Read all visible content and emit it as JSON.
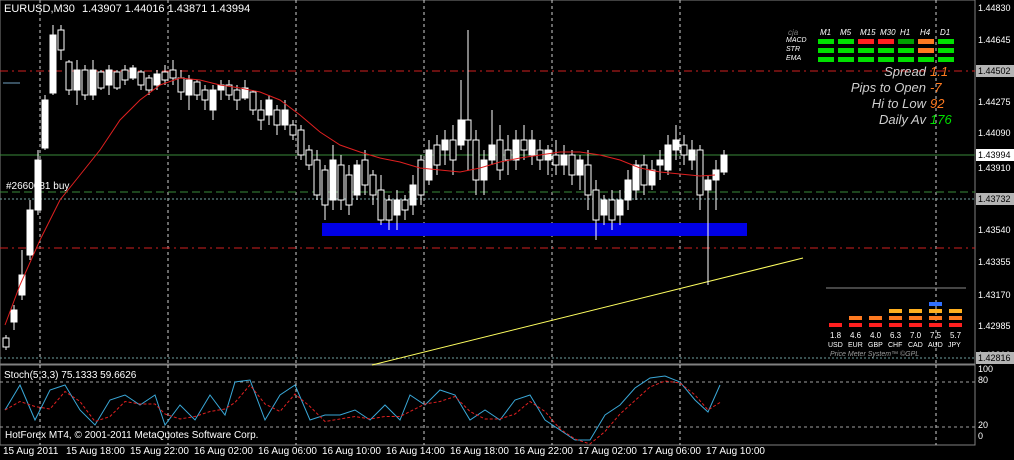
{
  "chart_header": {
    "symbol": "EURUSD,M30",
    "ohlc": "1.43907 1.44016 1.43871 1.43994"
  },
  "price_axis": [
    "1.44830",
    "1.44645",
    "1.44460",
    "1.44275",
    "1.44090",
    "1.43910",
    "1.43725",
    "1.43540",
    "1.43355",
    "1.43170",
    "1.42985",
    "1.42816"
  ],
  "price_boxes": [
    {
      "value": "1.44502",
      "color": "#b4b4b4"
    },
    {
      "value": "1.43994",
      "color": "#ffffff"
    },
    {
      "value": "1.43732",
      "color": "#b4b4b4"
    },
    {
      "value": "1.42816",
      "color": "#b4b4b4"
    }
  ],
  "time_axis": [
    "15 Aug 2011",
    "15 Aug 18:00",
    "15 Aug 22:00",
    "16 Aug 02:00",
    "16 Aug 06:00",
    "16 Aug 10:00",
    "16 Aug 14:00",
    "16 Aug 18:00",
    "16 Aug 22:00",
    "17 Aug 02:00",
    "17 Aug 06:00",
    "17 Aug 10:00"
  ],
  "order_label": "#2660081 buy",
  "stochastic": {
    "label": "Stoch(5,3,3) 75.1333 59.6626",
    "levels": [
      "100",
      "80",
      "20",
      "0"
    ]
  },
  "copyright": "HotForex MT4, © 2001-2011 MetaQuotes Software Corp.",
  "signal_grid": {
    "timeframes": [
      "M1",
      "M5",
      "M15",
      "M30",
      "H1",
      "H4",
      "D1"
    ],
    "rows": [
      {
        "name": "MACD",
        "colors": [
          "#00e000",
          "#00e000",
          "#ff2020",
          "#ff2020",
          "#00a000",
          "#ff7a20",
          "#00e000"
        ]
      },
      {
        "name": "STR",
        "colors": [
          "#00e000",
          "#00e000",
          "#00e000",
          "#00e000",
          "#00e000",
          "#ff7a20",
          "#00e000"
        ]
      },
      {
        "name": "EMA",
        "colors": [
          "#00e000",
          "#00e000",
          "#00e000",
          "#00e000",
          "#00e000",
          "#00e000",
          "#00e000"
        ]
      }
    ],
    "corner": "cja"
  },
  "stats": [
    {
      "label": "Spread",
      "value": "1.1",
      "color": "#ff7a20"
    },
    {
      "label": "Pips to Open",
      "value": "-7",
      "color": "#ff7a20"
    },
    {
      "label": "Hi to Low",
      "value": "92",
      "color": "#ff7a20"
    },
    {
      "label": "Daily Av",
      "value": "176",
      "color": "#00e000"
    }
  ],
  "price_meter": {
    "currencies": [
      {
        "code": "USD",
        "value": "1.8",
        "bars": 1
      },
      {
        "code": "EUR",
        "value": "4.6",
        "bars": 2
      },
      {
        "code": "GBP",
        "value": "4.0",
        "bars": 2
      },
      {
        "code": "CHF",
        "value": "6.3",
        "bars": 3
      },
      {
        "code": "CAD",
        "value": "7.0",
        "bars": 3
      },
      {
        "code": "AUD",
        "value": "7.5",
        "bars": 4
      },
      {
        "code": "JPY",
        "value": "5.7",
        "bars": 3
      }
    ],
    "caption": "Price Meter System™ ©GPL"
  },
  "colors": {
    "up": "#ffffff",
    "down": "#000000",
    "ma": "#e02020",
    "support_zone": "#0000e6",
    "trendline": "#ffff60",
    "stoch_main": "#3aa8d8",
    "stoch_signal": "#e02020"
  }
}
